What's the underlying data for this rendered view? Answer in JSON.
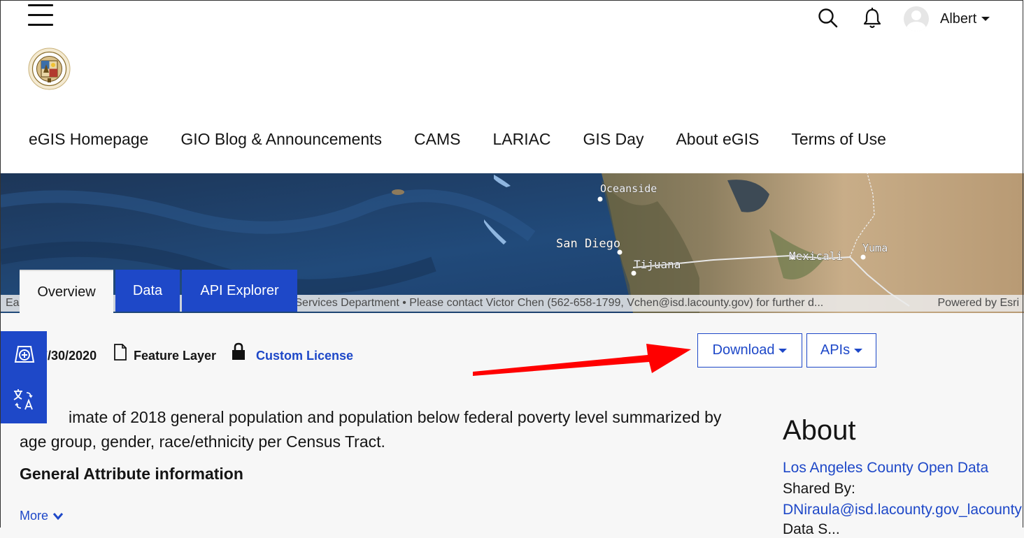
{
  "header": {
    "user_name": "Albert"
  },
  "nav": {
    "items": [
      "eGIS Homepage",
      "GIO Blog & Announcements",
      "CAMS",
      "LARIAC",
      "GIS Day",
      "About eGIS",
      "Terms of Use"
    ]
  },
  "map": {
    "labels": [
      "Oceanside",
      "San Diego",
      "Tijuana",
      "Mexicali",
      "Yuma"
    ],
    "attribution_left": "Ea                       nal Services Department • Please contact Victor Chen (562-658-1799, Vchen@isd.lacounty.gov) for further d...",
    "attribution_right": "Powered by Esri"
  },
  "tabs": {
    "overview": "Overview",
    "data": "Data",
    "api_explorer": "API Explorer"
  },
  "meta": {
    "date": "7/30/2020",
    "type": "Feature Layer",
    "license": "Custom License"
  },
  "buttons": {
    "download": "Download",
    "apis": "APIs"
  },
  "description": {
    "text_line1": "imate of 2018 general population and population below federal poverty level summarized by",
    "text_line2": "age group, gender, race/ethnicity per Census Tract.",
    "heading": "General Attribute information",
    "more": "More"
  },
  "about": {
    "title": "About",
    "org": "Los Angeles County Open Data",
    "shared_by_label": "Shared By:",
    "shared_by_user": "DNiraula@isd.lacounty.gov_lacounty",
    "next_label": "Data S..."
  },
  "colors": {
    "accent": "#1e48c8",
    "annotation_arrow": "#ff0000"
  }
}
